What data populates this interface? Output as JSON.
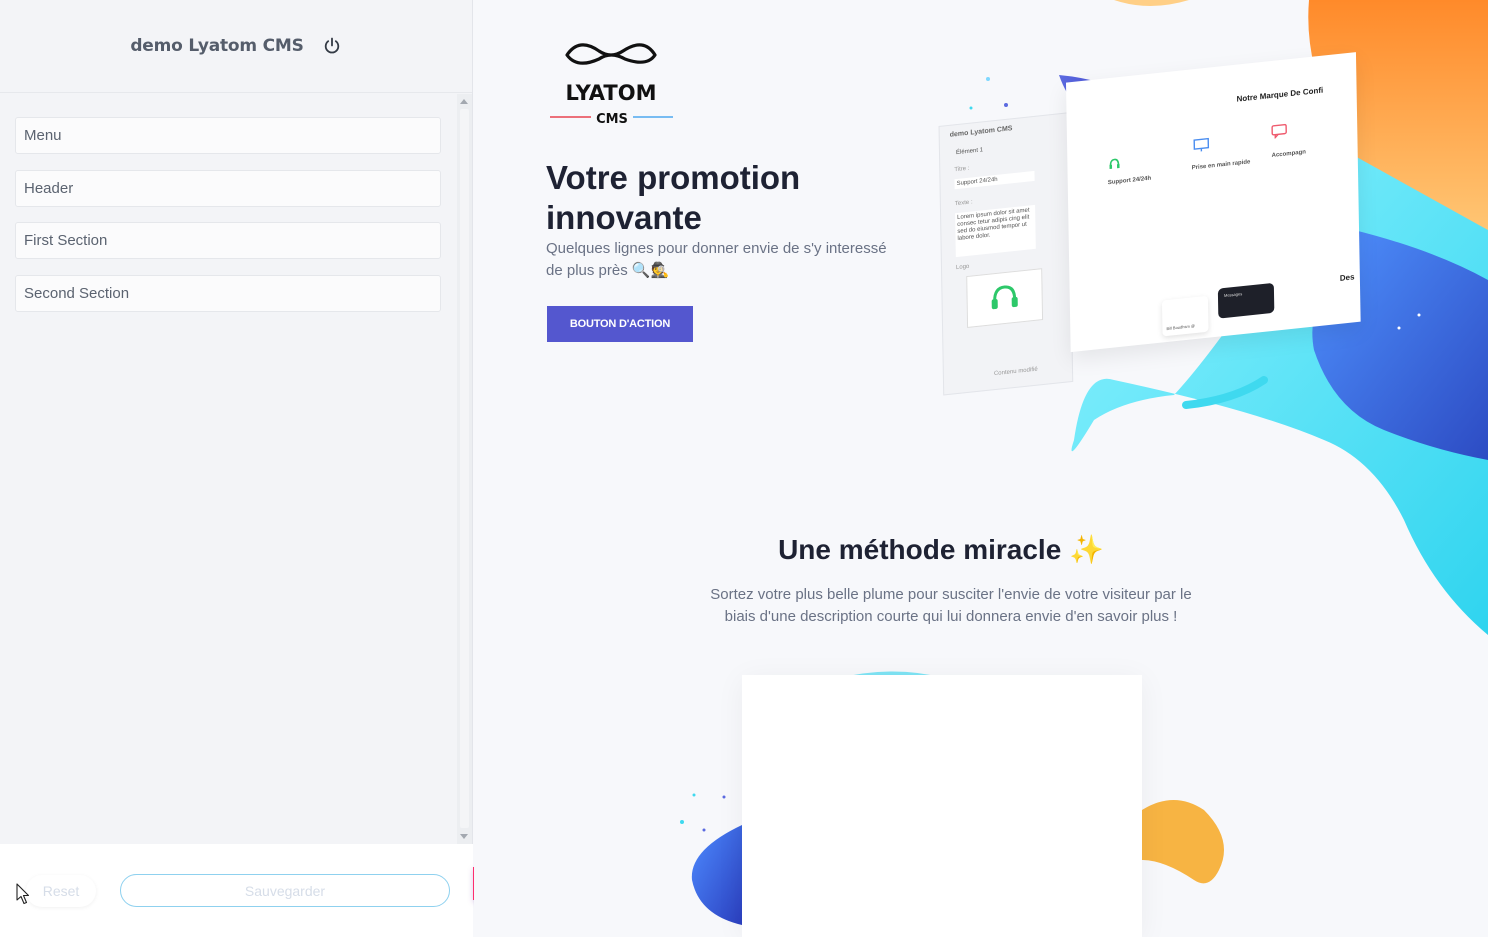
{
  "sidebar": {
    "title": "demo Lyatom CMS",
    "items": [
      {
        "label": "Menu"
      },
      {
        "label": "Header"
      },
      {
        "label": "First Section"
      },
      {
        "label": "Second Section"
      }
    ],
    "reset_label": "Reset",
    "save_label": "Sauvegarder"
  },
  "preview": {
    "logo": {
      "name": "LYATOM",
      "sub": "CMS"
    },
    "hero": {
      "title": "Votre promotion innovante",
      "subtitle": "Quelques lignes pour donner envie de s'y interessé de plus près 🔍🕵",
      "button": "BOUTON D'ACTION"
    },
    "mockup": {
      "app_title": "demo Lyatom CMS",
      "element": "Élément 1",
      "field_title": "Titre :",
      "field_title_value": "Support 24/24h",
      "field_text": "Texte :",
      "field_text_value": "Lorem ipsum dolor sit amet consec tetur adipis cing elit sed do eiusmod tempor ut labore dolor.",
      "field_logo": "Logo",
      "content_modified": "Contenu modifié",
      "brand_heading": "Notre Marque De Confi",
      "features": [
        {
          "title": "Support 24/24h"
        },
        {
          "title": "Prise en main rapide"
        },
        {
          "title": "Accompagn"
        }
      ],
      "author": "Bill Boudhsm @",
      "messages": "Messages",
      "des": "Des"
    },
    "section2": {
      "title": "Une méthode miracle ✨",
      "text": "Sortez votre plus belle plume pour susciter l'envie de votre visiteur par le biais d'une description courte qui lui donnera envie d'en savoir plus !"
    }
  },
  "colors": {
    "accent_blue": "#5457cf",
    "save_border": "#8fd1ef",
    "toggle_gradient_start": "#ff2e6d",
    "toggle_gradient_end": "#b23be6",
    "blob_orange": "#f7a23b",
    "blob_cyan": "#3fe0f0",
    "blob_blue": "#3b6fe0"
  },
  "icons": [
    "power-icon",
    "cursor-icon",
    "chevron-left-icon",
    "headset-icon",
    "monitor-icon",
    "chat-icon"
  ]
}
